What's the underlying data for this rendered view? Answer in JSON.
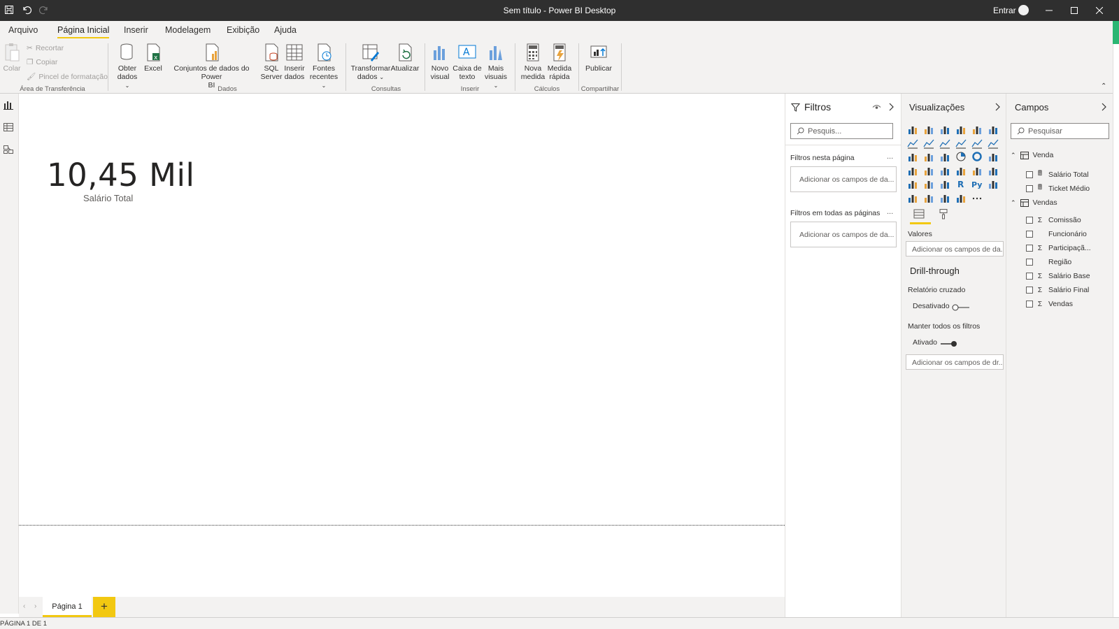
{
  "titlebar": {
    "title": "Sem título - Power BI Desktop",
    "signin": "Entrar"
  },
  "ribbon_tabs": [
    "Arquivo",
    "Página Inicial",
    "Inserir",
    "Modelagem",
    "Exibição",
    "Ajuda"
  ],
  "ribbon": {
    "paste": "Colar",
    "cut": "Recortar",
    "copy": "Copiar",
    "format_painter": "Pincel de formatação",
    "clipboard_group": "Área de Transferência",
    "get_data": [
      "Obter",
      "dados"
    ],
    "excel": "Excel",
    "pbi_datasets": [
      "Conjuntos de dados do Power",
      "BI"
    ],
    "sql": [
      "SQL",
      "Server"
    ],
    "enter_data": [
      "Inserir",
      "dados"
    ],
    "recent": [
      "Fontes",
      "recentes"
    ],
    "data_group": "Dados",
    "transform": [
      "Transformar",
      "dados"
    ],
    "refresh": "Atualizar",
    "queries_group": "Consultas",
    "new_visual": [
      "Novo",
      "visual"
    ],
    "textbox": [
      "Caixa de",
      "texto"
    ],
    "more_visuals": [
      "Mais",
      "visuais"
    ],
    "insert_group": "Inserir",
    "new_measure": [
      "Nova",
      "medida"
    ],
    "quick_measure": [
      "Medida",
      "rápida"
    ],
    "calc_group": "Cálculos",
    "publish": "Publicar",
    "share_group": "Compartilhar"
  },
  "canvas": {
    "card_value": "10,45 Mil",
    "card_label": "Salário Total"
  },
  "page_tabs": {
    "tab": "Página 1",
    "add": "+"
  },
  "status": "PÁGINA 1 DE 1",
  "filters": {
    "title": "Filtros",
    "search_placeholder": "Pesquis...",
    "page_filters": "Filtros nesta página",
    "all_pages_filters": "Filtros em todas as páginas",
    "drop_hint": "Adicionar os campos de da...",
    "more": "..."
  },
  "visualizations": {
    "title": "Visualizações",
    "values_label": "Valores",
    "values_drop": "Adicionar os campos de da...",
    "drillthrough": "Drill-through",
    "cross_report": "Relatório cruzado",
    "cross_report_state": "Desativado",
    "keep_filters": "Manter todos os filtros",
    "keep_filters_state": "Ativado",
    "drill_drop": "Adicionar os campos de dr..."
  },
  "fields": {
    "title": "Campos",
    "search_placeholder": "Pesquisar",
    "tables": [
      {
        "name": "Venda",
        "fields": [
          {
            "name": "Salário Total",
            "type": "measure"
          },
          {
            "name": "Ticket Médio",
            "type": "measure"
          }
        ]
      },
      {
        "name": "Vendas",
        "fields": [
          {
            "name": "Comissão",
            "type": "sum"
          },
          {
            "name": "Funcionário",
            "type": "text"
          },
          {
            "name": "Participaçã...",
            "type": "sum"
          },
          {
            "name": "Região",
            "type": "text"
          },
          {
            "name": "Salário Base",
            "type": "sum"
          },
          {
            "name": "Salário Final",
            "type": "sum"
          },
          {
            "name": "Vendas",
            "type": "sum"
          }
        ]
      }
    ]
  },
  "colors": {
    "accent_yellow": "#f2c811",
    "titlebar": "#2f2f2f",
    "ribbon_bg": "#f3f2f1"
  }
}
